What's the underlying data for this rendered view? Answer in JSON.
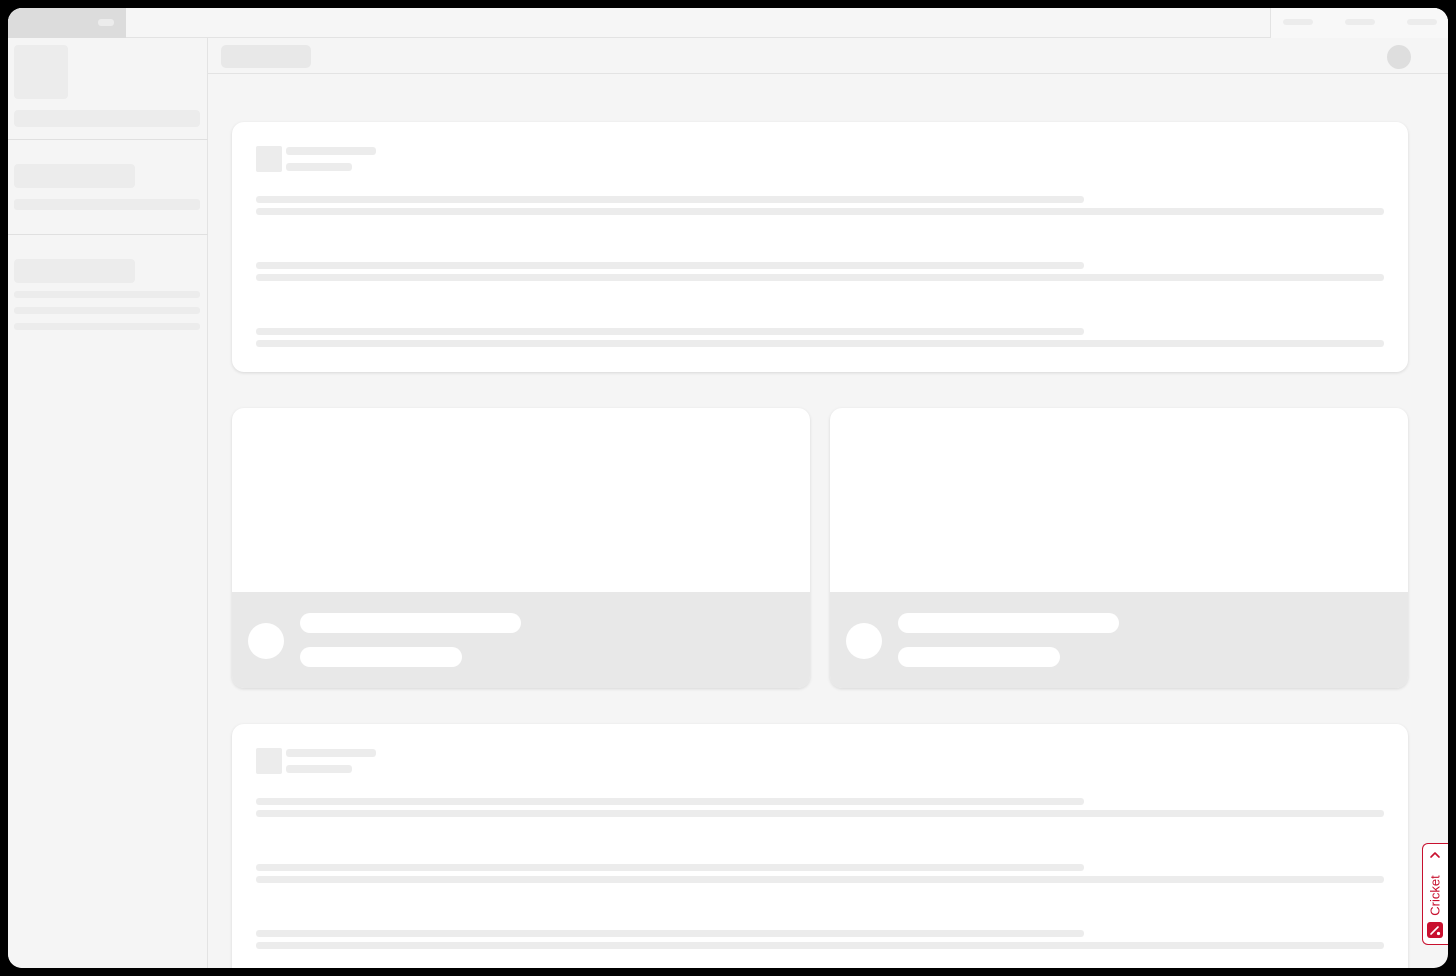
{
  "widget": {
    "label": "Cricket",
    "accent_color": "#c8102e",
    "icons": {
      "toggle": "chevron-up-icon",
      "logo": "cricket-bat-icon"
    }
  },
  "page_state": "loading-skeleton"
}
